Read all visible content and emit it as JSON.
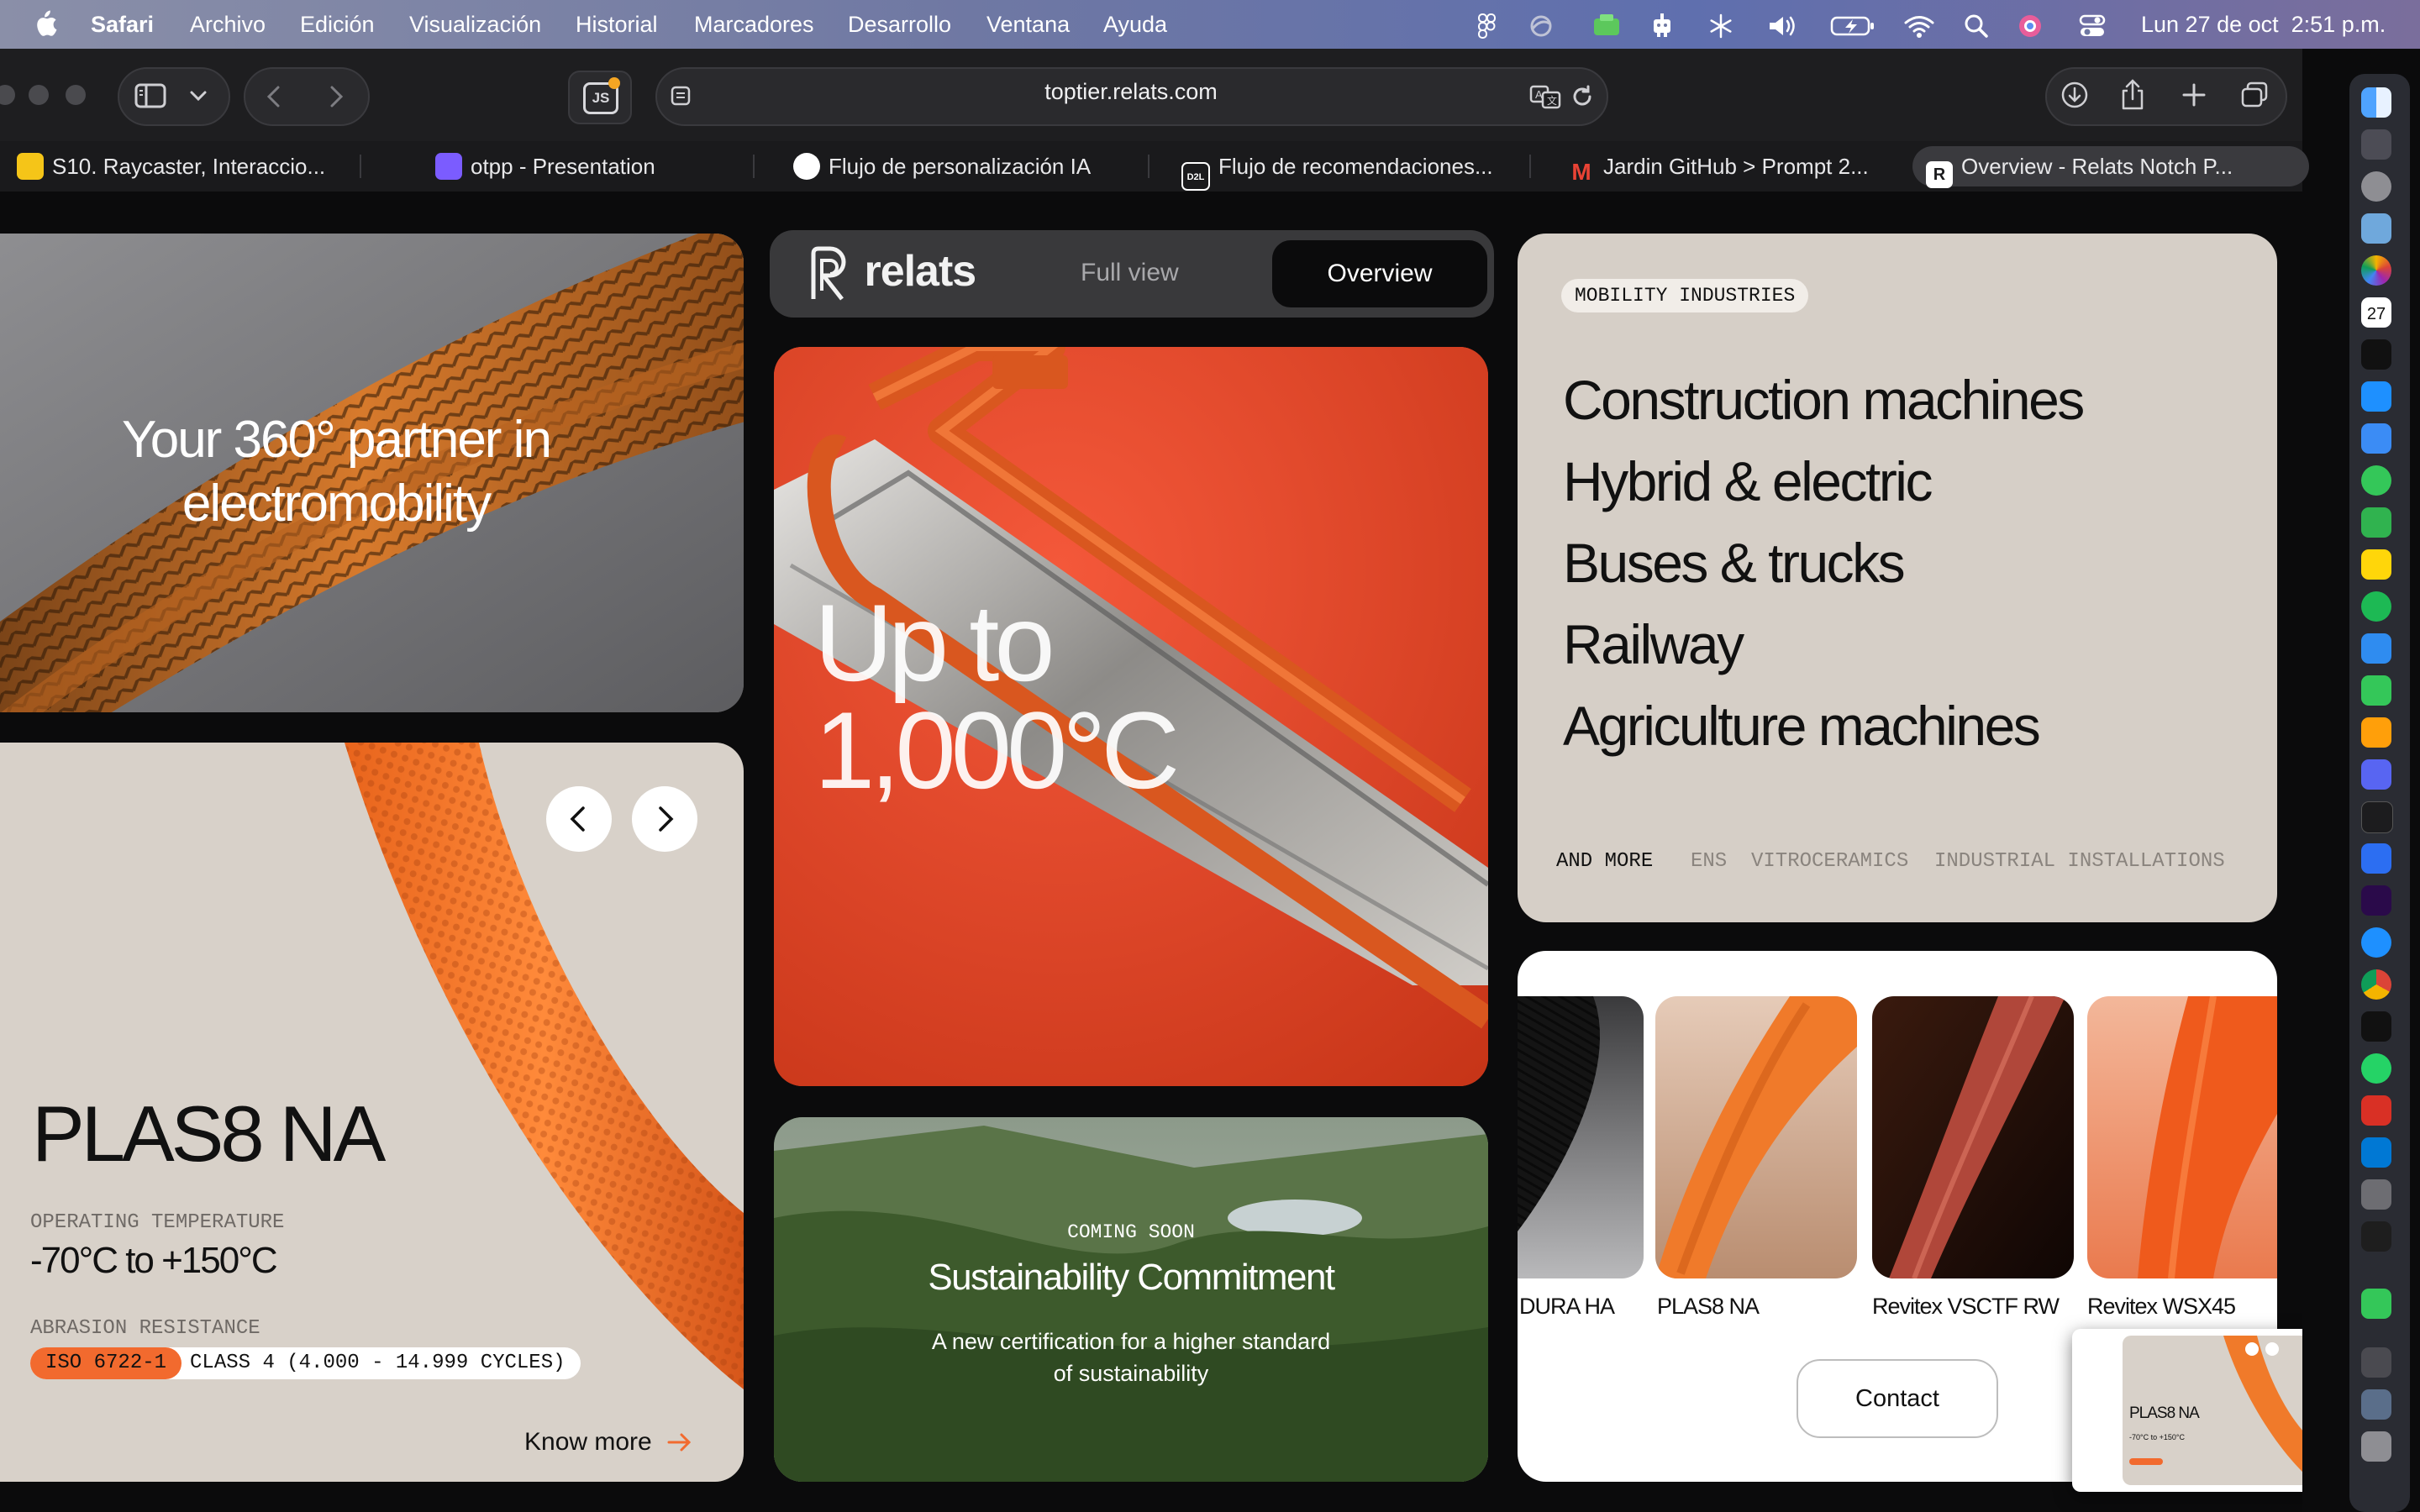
{
  "menubar": {
    "apple": "",
    "app": "Safari",
    "items": [
      "Archivo",
      "Edición",
      "Visualización",
      "Historial",
      "Marcadores",
      "Desarrollo",
      "Ventana",
      "Ayuda"
    ],
    "clock": "Lun 27 de oct  2:51 p.m."
  },
  "browser": {
    "url": "toptier.relats.com",
    "js_badge": "JS",
    "tabs": [
      {
        "label": "S10. Raycaster, Interaccio...",
        "color": "#f5c518"
      },
      {
        "label": "otpp - Presentation",
        "color": "#7b5cff"
      },
      {
        "label": "Flujo de personalización IA",
        "color": "#ffffff"
      },
      {
        "label": "Flujo de recomendaciones...",
        "color": "#ffffff",
        "fav_text": "D2L"
      },
      {
        "label": "Jardin GitHub > Prompt 2...",
        "color": "#ea4335",
        "fav_text": "M"
      },
      {
        "label": "Overview - Relats Notch P...",
        "color": "#ffffff"
      }
    ]
  },
  "hero_card": {
    "title": "Your 360° partner in electromobility"
  },
  "nav": {
    "logo": "relats",
    "tab_full": "Full view",
    "tab_overview": "Overview"
  },
  "temp_card": {
    "big_text": "Up to 1,000°C"
  },
  "product_card": {
    "name": "PLAS8 NA",
    "temp_label": "OPERATING TEMPERATURE",
    "temp_value": "-70°C to +150°C",
    "abrasion_label": "ABRASION RESISTANCE",
    "iso": "ISO 6722-1",
    "class": "CLASS 4 (4.000 - 14.999 CYCLES)",
    "know_more": "Know more"
  },
  "industries": {
    "badge": "MOBILITY INDUSTRIES",
    "items": [
      "Construction machines",
      "Hybrid & electric",
      "Buses & trucks",
      "Railway",
      "Agriculture machines"
    ],
    "more_label": "AND MORE",
    "more": [
      "ENS",
      "VITROCERAMICS",
      "INDUSTRIAL INSTALLATIONS"
    ]
  },
  "sustain": {
    "eyebrow": "COMING SOON",
    "title": "Sustainability Commitment",
    "desc": "A new certification for a higher standard of sustainability"
  },
  "products": {
    "items": [
      "DURA HA",
      "PLAS8 NA",
      "Revitex VSCTF RW",
      "Revitex WSX45"
    ],
    "contact": "Contact"
  },
  "thumbnail": {
    "name": "PLAS8 NA",
    "temp": "-70°C to +150°C"
  },
  "colors": {
    "accent": "#f26a2e",
    "card_beige": "#d6cfc7",
    "chrome": "#1e1e20"
  }
}
